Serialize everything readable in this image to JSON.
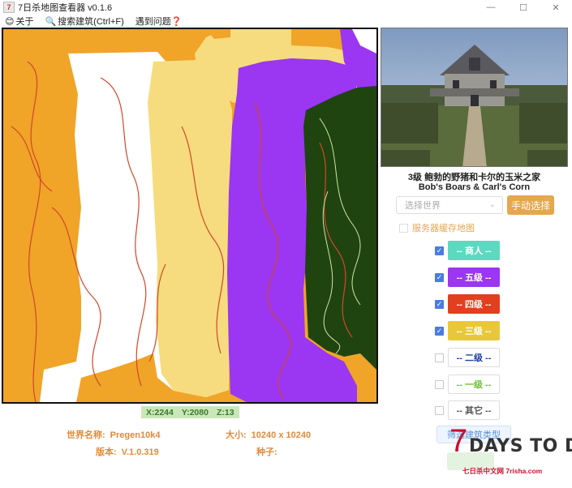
{
  "window": {
    "title": "7日杀地图查看器 v0.1.6",
    "icon_text": "7",
    "minimize": "—",
    "maximize": "☐",
    "close": "✕"
  },
  "menu": [
    {
      "icon": "smiley-icon",
      "glyph": "😊",
      "label": "关于"
    },
    {
      "icon": "magnifier-icon",
      "glyph": "🔍",
      "label": "搜索建筑(Ctrl+F)"
    },
    {
      "icon": "",
      "glyph": "",
      "label": "遇到问题"
    },
    {
      "icon": "question-icon",
      "glyph": "❓",
      "label": ""
    }
  ],
  "map": {
    "colors": {
      "orange": "#f0a428",
      "white": "#ffffff",
      "yellow": "#f6dc7e",
      "purple": "#9b36f2",
      "forest": "#1f4410",
      "road": "#d0482a",
      "trail": "#cde8a5"
    }
  },
  "coords": {
    "x": "X:2244",
    "y": "Y:2080",
    "z": "Z:13"
  },
  "info": {
    "world_label": "世界名称:",
    "world_value": "Pregen10k4",
    "size_label": "大小:",
    "size_value": "10240 x 10240",
    "version_label": "版本:",
    "version_value": "V.1.0.319",
    "seed_label": "种子:",
    "seed_value": ""
  },
  "building": {
    "name_cn": "3级  鲍勃的野猪和卡尔的玉米之家",
    "name_en": "Bob's Boars & Carl's Corn"
  },
  "controls": {
    "world_select_placeholder": "选择世界",
    "manual_select": "手动选择",
    "server_cache": "服务器缓存地图",
    "type_button": "筛选建筑类型"
  },
  "filters": [
    {
      "label": "-- 商人 --",
      "checked": true,
      "bg": "#5dd9bf",
      "fg": "#ffffff",
      "border": "#5dd9bf"
    },
    {
      "label": "-- 五级 --",
      "checked": true,
      "bg": "#9b36f2",
      "fg": "#ffffff",
      "border": "#9b36f2"
    },
    {
      "label": "-- 四级 --",
      "checked": true,
      "bg": "#e0401e",
      "fg": "#ffffff",
      "border": "#e0401e"
    },
    {
      "label": "-- 三级 --",
      "checked": true,
      "bg": "#e8c83a",
      "fg": "#ffffff",
      "border": "#e8c83a"
    },
    {
      "label": "-- 二级 --",
      "checked": false,
      "bg": "#ffffff",
      "fg": "#1f3fa6",
      "border": "#dddddd"
    },
    {
      "label": "-- 一级 --",
      "checked": false,
      "bg": "#ffffff",
      "fg": "#6cc23a",
      "border": "#dddddd"
    },
    {
      "label": "-- 其它 --",
      "checked": false,
      "bg": "#ffffff",
      "fg": "#555555",
      "border": "#dddddd"
    }
  ],
  "logo": {
    "seven": "7",
    "title": "DAYS TO DIE",
    "subtitle": "七日杀中文网 7risha.com"
  }
}
